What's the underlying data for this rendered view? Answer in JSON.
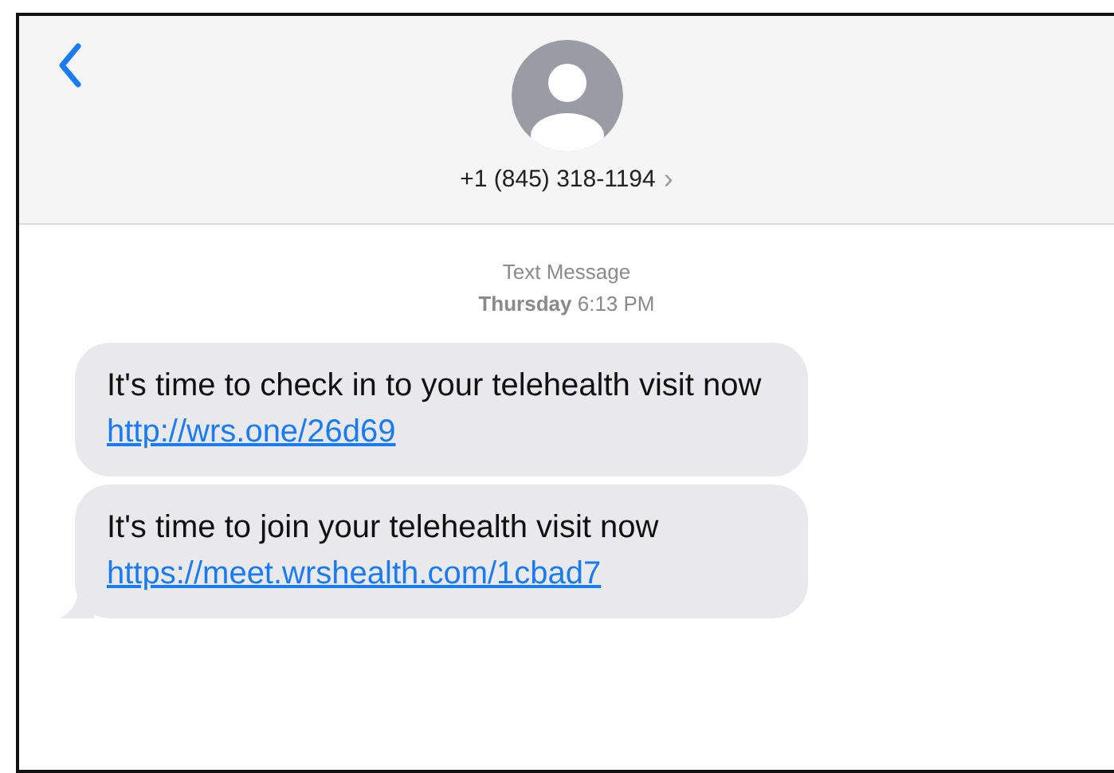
{
  "header": {
    "contact": "+1 (845) 318-1194",
    "chevron": "›"
  },
  "timestamp": {
    "label": "Text Message",
    "day": "Thursday",
    "time": "6:13 PM"
  },
  "messages": [
    {
      "text": "It's time to check in to your telehealth visit now",
      "link": "http://wrs.one/26d69",
      "tail": false
    },
    {
      "text": "It's time to join your telehealth visit now",
      "link": "https://meet.wrshealth.com/1cbad7",
      "tail": true
    }
  ]
}
